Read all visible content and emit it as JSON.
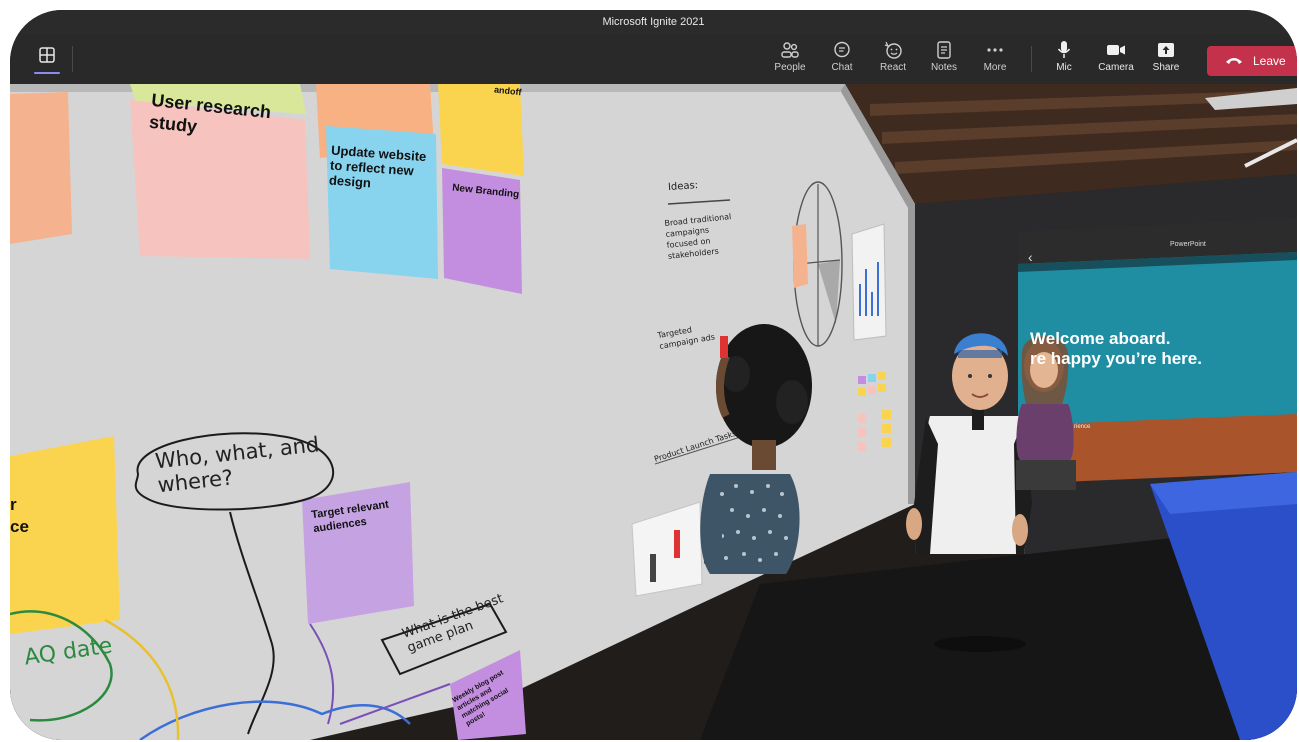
{
  "window": {
    "title": "Microsoft Ignite 2021"
  },
  "toolbar": {
    "people": "People",
    "chat": "Chat",
    "react": "React",
    "notes": "Notes",
    "more": "More",
    "mic": "Mic",
    "camera": "Camera",
    "share": "Share",
    "leave": "Leave"
  },
  "whiteboard": {
    "notes": {
      "user_research": "User research study",
      "update_website": "Update website to reflect new design",
      "new_branding": "New Branding",
      "handoff": "andoff",
      "audience": "r ce",
      "target_audiences": "Target relevant audiences",
      "weekly_blog": "Weekly blog post articles and matching social posts!"
    },
    "handwriting": {
      "who_what_where": "Who, what, and where?",
      "game_plan": "What is the best game plan",
      "faq": "AQ date",
      "ideas": "Ideas:",
      "idea1": "Broad traditional campaigns focused on stakeholders",
      "idea2": "Targeted campaign ads",
      "product_launch": "Product Launch Tasks"
    }
  },
  "powerpoint": {
    "app_title": "PowerPoint",
    "slide_line1": "Welcome aboard.",
    "slide_line2": "re happy you’re here.",
    "slide_footer": "rience"
  },
  "colors": {
    "leave_red": "#c4314b",
    "accent": "#8c8cf0",
    "slide_teal": "#1f8ea3"
  }
}
